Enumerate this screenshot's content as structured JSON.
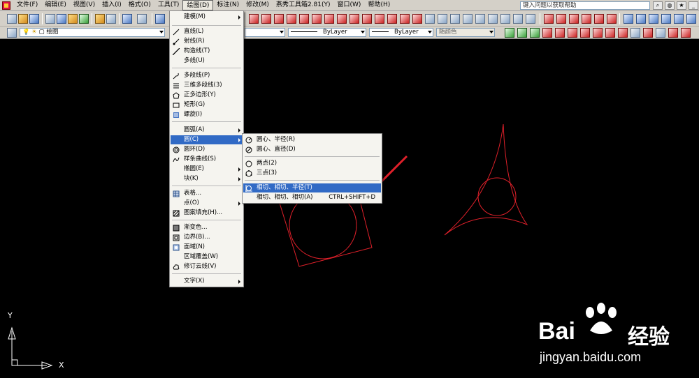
{
  "menubar": {
    "items": [
      "文件(F)",
      "编辑(E)",
      "视图(V)",
      "插入(I)",
      "格式(O)",
      "工具(T)",
      "绘图(D)",
      "标注(N)",
      "修改(M)",
      "燕秀工具箱2.81(Y)",
      "窗口(W)",
      "帮助(H)"
    ],
    "help_placeholder": "键入问题以获取帮助"
  },
  "layers_toolbar": {
    "layer_name": "绘图",
    "linetype": "ByLayer",
    "lineweight": "ByLayer",
    "color": "随颜色"
  },
  "draw_menu": {
    "items": [
      {
        "label": "建模(M)",
        "submenu": true,
        "icon": "none"
      },
      {
        "label": "直线(L)",
        "icon": "line-icon"
      },
      {
        "label": "射线(R)",
        "icon": "ray-icon"
      },
      {
        "label": "构造线(T)",
        "icon": "xline-icon"
      },
      {
        "label": "多线(U)",
        "icon": "none"
      },
      {
        "label": "多段线(P)",
        "icon": "polyline-icon"
      },
      {
        "label": "三维多段线(3)",
        "icon": "3dpolyline-icon"
      },
      {
        "label": "正多边形(Y)",
        "icon": "polygon-icon"
      },
      {
        "label": "矩形(G)",
        "icon": "rectangle-icon"
      },
      {
        "label": "螺旋(I)",
        "icon": "helix-icon"
      },
      {
        "label": "圆弧(A)",
        "submenu": true,
        "icon": "none"
      },
      {
        "label": "圆(C)",
        "submenu": true,
        "icon": "none",
        "highlighted": true
      },
      {
        "label": "圆环(D)",
        "icon": "donut-icon"
      },
      {
        "label": "样条曲线(S)",
        "icon": "spline-icon"
      },
      {
        "label": "椭圆(E)",
        "submenu": true,
        "icon": "none"
      },
      {
        "label": "块(K)",
        "submenu": true,
        "icon": "none"
      },
      {
        "label": "表格...",
        "icon": "table-icon"
      },
      {
        "label": "点(O)",
        "submenu": true,
        "icon": "none"
      },
      {
        "label": "图案填充(H)...",
        "icon": "hatch-icon"
      },
      {
        "label": "渐变色...",
        "icon": "gradient-icon"
      },
      {
        "label": "边界(B)...",
        "icon": "boundary-icon"
      },
      {
        "label": "面域(N)",
        "icon": "region-icon"
      },
      {
        "label": "区域覆盖(W)",
        "icon": "none"
      },
      {
        "label": "修订云线(V)",
        "icon": "revcloud-icon"
      },
      {
        "label": "文字(X)",
        "submenu": true,
        "icon": "none"
      }
    ]
  },
  "circle_menu": {
    "items": [
      {
        "label": "圆心、半径(R)",
        "icon": "circle-center-radius-icon"
      },
      {
        "label": "圆心、直径(D)",
        "icon": "circle-center-diameter-icon"
      },
      {
        "label": "两点(2)",
        "icon": "circle-2p-icon"
      },
      {
        "label": "三点(3)",
        "icon": "circle-3p-icon"
      },
      {
        "label": "相切、相切、半径(T)",
        "icon": "circle-ttr-icon",
        "highlighted": true
      },
      {
        "label": "相切、相切、相切(A)",
        "shortcut": "CTRL+SHIFT+D",
        "icon": "none"
      }
    ]
  },
  "ucs": {
    "x_label": "X",
    "y_label": "Y"
  },
  "watermark": {
    "brand": "Bai",
    "brand_cn": "经验",
    "url": "jingyan.baidu.com"
  },
  "colors": {
    "drawing": "#e0202a",
    "highlight": "#316ac5",
    "annotation_arrow": "#e0202a"
  }
}
